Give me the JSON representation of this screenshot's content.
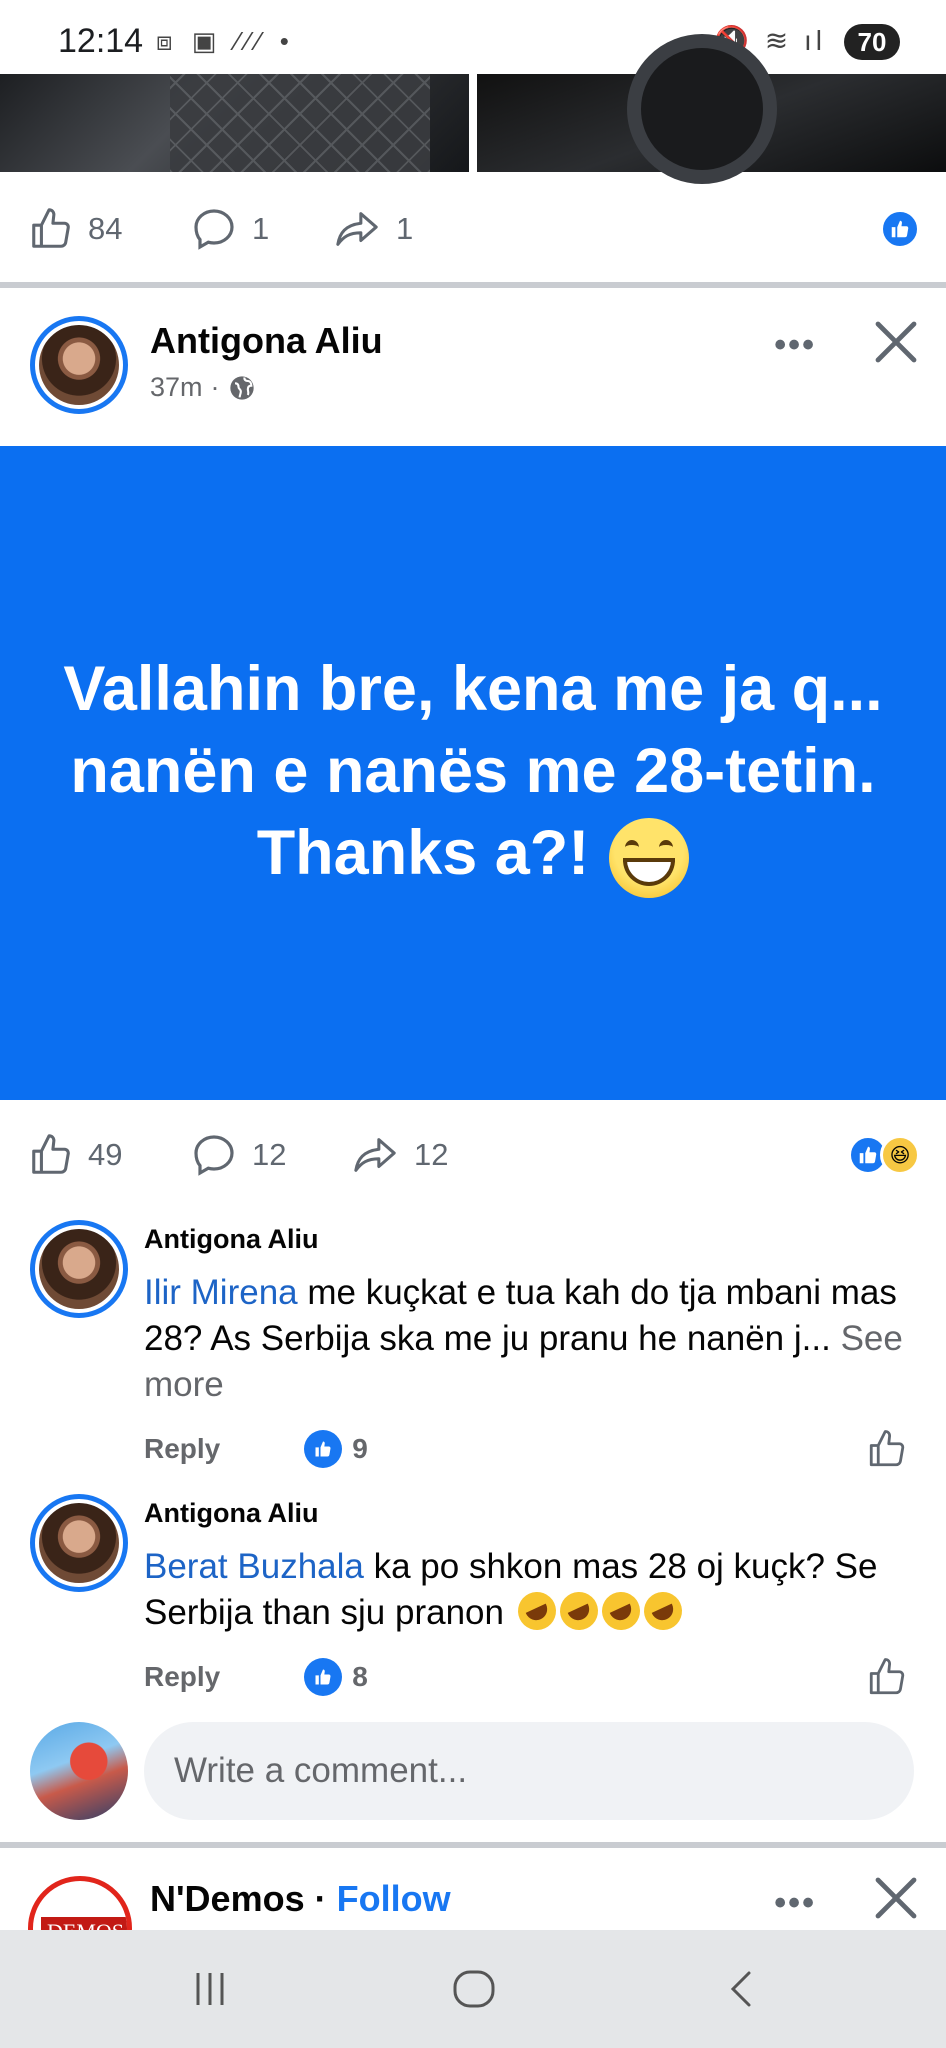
{
  "status_bar": {
    "time": "12:14",
    "battery": "70"
  },
  "prev_post": {
    "likes": "84",
    "comments": "1",
    "shares": "1"
  },
  "post": {
    "author": "Antigona Aliu",
    "time": "37m",
    "privacy_icon": "globe-icon",
    "status_text": "Vallahin bre, kena me ja q... nanën e nanës me 28-tetin. Thanks a?!",
    "status_emoji": "grinning-squinting-face",
    "background_color": "#0b6ff1",
    "likes": "49",
    "comments": "12",
    "shares": "12",
    "reactions": [
      "like",
      "haha"
    ]
  },
  "comments": [
    {
      "author": "Antigona Aliu",
      "mention": "Ilir Mirena",
      "text": " me kuçkat e tua kah do tja mbani mas 28? As Serbija ska me ju pranu he nanën j...",
      "see_more": "See more",
      "reply_label": "Reply",
      "likes": "9"
    },
    {
      "author": "Antigona Aliu",
      "mention": "Berat Buzhala",
      "text": " ka po shkon mas 28 oj kuçk? Se Serbija than sju pranon",
      "emojis": [
        "rofl",
        "rofl",
        "rofl",
        "rofl"
      ],
      "reply_label": "Reply",
      "likes": "8"
    }
  ],
  "comment_box": {
    "placeholder": "Write a comment..."
  },
  "next_post": {
    "author": "N'Demos",
    "separator": " · ",
    "follow_label": "Follow",
    "logo_text": "DEMOS"
  },
  "colors": {
    "accent": "#1877f2",
    "mention": "#1d64c6",
    "muted": "#65676b"
  }
}
